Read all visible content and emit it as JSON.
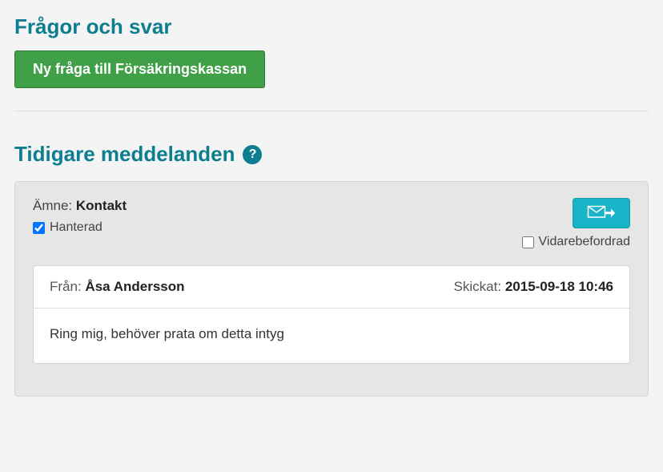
{
  "page": {
    "title": "Frågor och svar",
    "new_question_button": "Ny fråga till Försäkringskassan"
  },
  "previous": {
    "title": "Tidigare meddelanden",
    "help_symbol": "?"
  },
  "message": {
    "subject_label": "Ämne:",
    "subject_value": "Kontakt",
    "handled": {
      "label": "Hanterad",
      "checked": true
    },
    "forwarded": {
      "label": "Vidarebefordrad",
      "checked": false
    },
    "from_label": "Från:",
    "from_name": "Åsa Andersson",
    "sent_label": "Skickat:",
    "sent_value": "2015-09-18 10:46",
    "body": "Ring mig, behöver prata om detta intyg"
  }
}
